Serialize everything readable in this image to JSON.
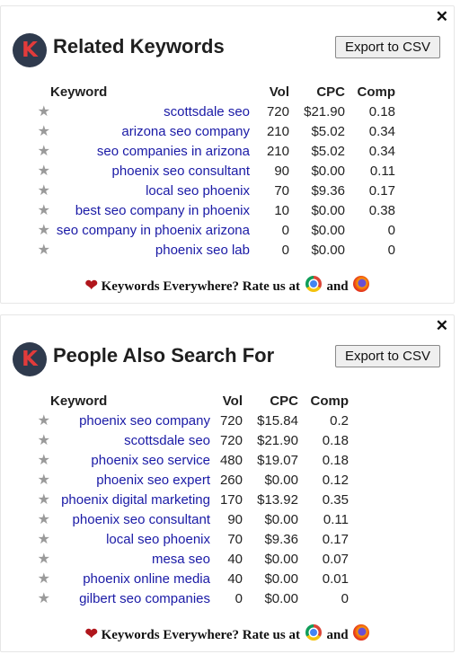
{
  "related": {
    "title": "Related Keywords",
    "export_label": "Export to CSV",
    "close": "✕",
    "logo": "K",
    "headers": {
      "keyword": "Keyword",
      "vol": "Vol",
      "cpc": "CPC",
      "comp": "Comp"
    },
    "rows": [
      {
        "keyword": "scottsdale seo",
        "vol": "720",
        "cpc": "$21.90",
        "comp": "0.18"
      },
      {
        "keyword": "arizona seo company",
        "vol": "210",
        "cpc": "$5.02",
        "comp": "0.34"
      },
      {
        "keyword": "seo companies in arizona",
        "vol": "210",
        "cpc": "$5.02",
        "comp": "0.34"
      },
      {
        "keyword": "phoenix seo consultant",
        "vol": "90",
        "cpc": "$0.00",
        "comp": "0.11"
      },
      {
        "keyword": "local seo phoenix",
        "vol": "70",
        "cpc": "$9.36",
        "comp": "0.17"
      },
      {
        "keyword": "best seo company in phoenix",
        "vol": "10",
        "cpc": "$0.00",
        "comp": "0.38"
      },
      {
        "keyword": "seo company in phoenix arizona",
        "vol": "0",
        "cpc": "$0.00",
        "comp": "0"
      },
      {
        "keyword": "phoenix seo lab",
        "vol": "0",
        "cpc": "$0.00",
        "comp": "0"
      }
    ],
    "rate_text_1": "Keywords Everywhere? Rate us at",
    "rate_text_2": "and"
  },
  "pasf": {
    "title": "People Also Search For",
    "export_label": "Export to CSV",
    "close": "✕",
    "logo": "K",
    "headers": {
      "keyword": "Keyword",
      "vol": "Vol",
      "cpc": "CPC",
      "comp": "Comp"
    },
    "rows": [
      {
        "keyword": "phoenix seo company",
        "vol": "720",
        "cpc": "$15.84",
        "comp": "0.2"
      },
      {
        "keyword": "scottsdale seo",
        "vol": "720",
        "cpc": "$21.90",
        "comp": "0.18"
      },
      {
        "keyword": "phoenix seo service",
        "vol": "480",
        "cpc": "$19.07",
        "comp": "0.18"
      },
      {
        "keyword": "phoenix seo expert",
        "vol": "260",
        "cpc": "$0.00",
        "comp": "0.12"
      },
      {
        "keyword": "phoenix digital marketing",
        "vol": "170",
        "cpc": "$13.92",
        "comp": "0.35"
      },
      {
        "keyword": "phoenix seo consultant",
        "vol": "90",
        "cpc": "$0.00",
        "comp": "0.11"
      },
      {
        "keyword": "local seo phoenix",
        "vol": "70",
        "cpc": "$9.36",
        "comp": "0.17"
      },
      {
        "keyword": "mesa seo",
        "vol": "40",
        "cpc": "$0.00",
        "comp": "0.07"
      },
      {
        "keyword": "phoenix online media",
        "vol": "40",
        "cpc": "$0.00",
        "comp": "0.01"
      },
      {
        "keyword": "gilbert seo companies",
        "vol": "0",
        "cpc": "$0.00",
        "comp": "0"
      }
    ],
    "rate_text_1": "Keywords Everywhere? Rate us at",
    "rate_text_2": "and"
  },
  "icons": {
    "star": "★",
    "heart": "❤"
  },
  "colors": {
    "link": "#1a1aa6",
    "logo_bg": "#2f3a4d",
    "logo_letter": "#e23b3b",
    "heart": "#b0161c",
    "star": "#9a9a9a"
  }
}
